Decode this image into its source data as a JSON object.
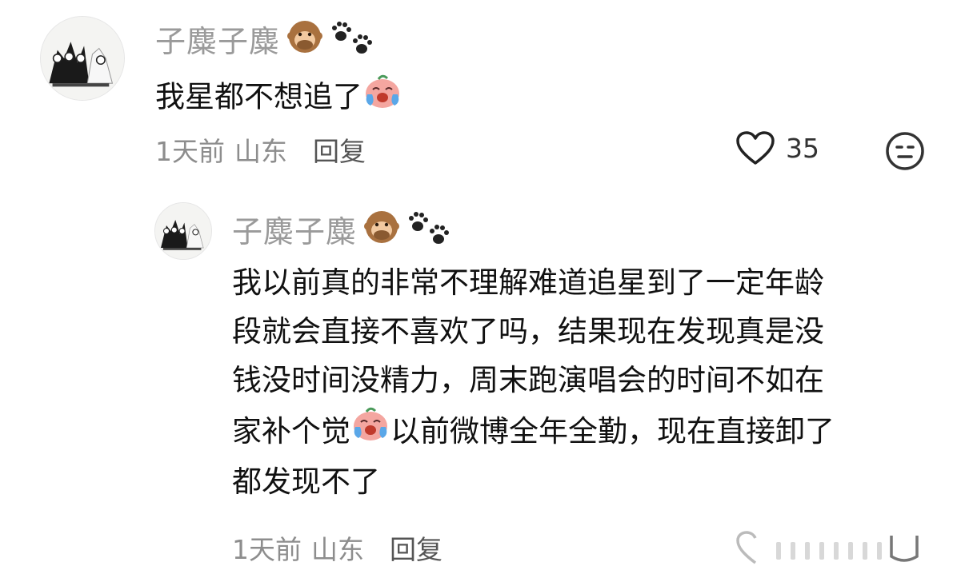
{
  "comments": [
    {
      "username": "子麋子麋",
      "name_emojis": [
        "monkey-icon",
        "paw-print-icon"
      ],
      "text": "我星都不想追了",
      "text_emoji": "crying-face-icon",
      "time": "1天前",
      "location": "山东",
      "reply_label": "回复",
      "like_count": "35"
    },
    {
      "username": "子麋子麋",
      "name_emojis": [
        "monkey-icon",
        "paw-print-icon"
      ],
      "lines": [
        "我以前真的非常不理解难道追星到了一定年龄",
        "段就会直接不喜欢了吗，结果现在发现真是没",
        "钱没时间没精力，周末跑演唱会的时间不如在",
        "家补个觉",
        "以前微博全年全勤，现在直接卸了",
        "都发现不了"
      ],
      "text_emoji": "crying-face-icon",
      "time": "1天前",
      "location": "山东",
      "reply_label": "回复"
    }
  ],
  "colors": {
    "username": "#9a9a9a",
    "meta": "#8d8d8d",
    "text": "#111111"
  }
}
